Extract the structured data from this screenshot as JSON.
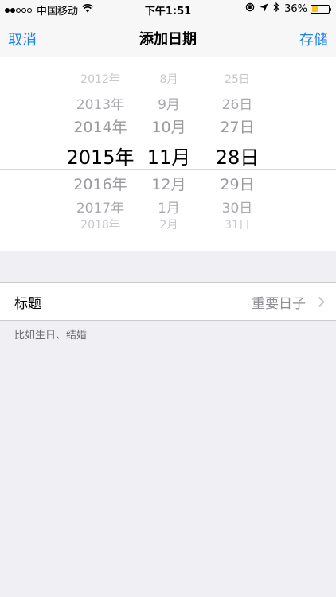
{
  "status_bar": {
    "carrier": "中国移动",
    "time": "下午1:51",
    "battery_percent": "36%",
    "battery_level": 0.36,
    "signal_strength": 2
  },
  "nav": {
    "cancel_label": "取消",
    "title": "添加日期",
    "save_label": "存储"
  },
  "picker": {
    "years": [
      "2012年",
      "2013年",
      "2014年",
      "2015年",
      "2016年",
      "2017年",
      "2018年"
    ],
    "months": [
      "8月",
      "9月",
      "10月",
      "11月",
      "12月",
      "1月",
      "2月"
    ],
    "days": [
      "25日",
      "26日",
      "27日",
      "28日",
      "29日",
      "30日",
      "31日"
    ],
    "selected": {
      "year": "2015年",
      "month": "11月",
      "day": "28日"
    }
  },
  "title_row": {
    "label": "标题",
    "value": "重要日子"
  },
  "hint": "比如生日、结婚"
}
